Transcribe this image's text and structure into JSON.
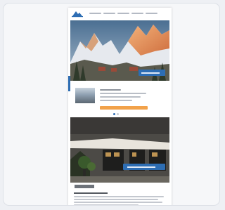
{
  "viewer": {
    "page_label": "",
    "header": {
      "nav_count": 5
    },
    "hero": {
      "cta_label": ""
    },
    "promo": {
      "button_label": ""
    },
    "hotel": {
      "sign_line_1": "",
      "sign_line_2": "",
      "cta_label": ""
    },
    "carousel": {
      "slides": 3,
      "active": 1
    }
  },
  "colors": {
    "accent": "#2d6db3",
    "promo_button": "#f2a24a",
    "background": "#eef0f4",
    "card": "#f6f7f9"
  }
}
